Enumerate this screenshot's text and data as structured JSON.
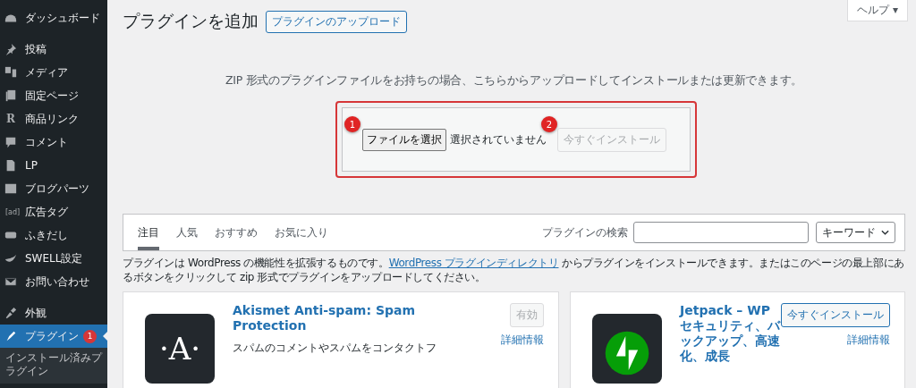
{
  "sidebar": {
    "groups": [
      [
        {
          "label": "ダッシュボード",
          "selected": false
        }
      ],
      [
        {
          "label": "投稿",
          "selected": false
        },
        {
          "label": "メディア",
          "selected": false
        },
        {
          "label": "固定ページ",
          "selected": false
        },
        {
          "label": "商品リンク",
          "selected": false,
          "icon_text": "R"
        },
        {
          "label": "コメント",
          "selected": false
        },
        {
          "label": "LP",
          "selected": false
        },
        {
          "label": "ブログパーツ",
          "selected": false
        },
        {
          "label": "広告タグ",
          "selected": false,
          "icon_text": "[ad]"
        },
        {
          "label": "ふきだし",
          "selected": false
        },
        {
          "label": "SWELL設定",
          "selected": false
        },
        {
          "label": "お問い合わせ",
          "selected": false
        }
      ],
      [
        {
          "label": "外観",
          "selected": false
        },
        {
          "label": "プラグイン",
          "selected": true,
          "badge": "1",
          "children": [
            {
              "label": "インストール済みプラグイン",
              "selected": false
            }
          ]
        }
      ]
    ]
  },
  "header": {
    "title": "プラグインを追加",
    "upload_button": "プラグインのアップロード",
    "help": "ヘルプ ▾"
  },
  "upload": {
    "text": "ZIP 形式のプラグインファイルをお持ちの場合、こちらからアップロードしてインストールまたは更新できます。",
    "file_button": "ファイルを選択",
    "file_status": "選択されていません",
    "install_button": {
      "label": "今すぐインストール",
      "disabled": true
    },
    "markers": [
      "1",
      "2"
    ]
  },
  "filter": {
    "tabs": [
      {
        "label": "注目",
        "selected": true
      },
      {
        "label": "人気",
        "selected": false
      },
      {
        "label": "おすすめ",
        "selected": false
      },
      {
        "label": "お気に入り",
        "selected": false
      }
    ],
    "search_label": "プラグインの検索",
    "search_type": "キーワード"
  },
  "intro": {
    "before": "プラグインは WordPress の機能性を拡張するものです。",
    "link": "WordPress プラグインディレクトリ",
    "after": " からプラグインをインストールできます。またはこのページの最上部にあるボタンをクリックして zip 形式でプラグインをアップロードしてください。"
  },
  "plugins": [
    {
      "kind": "akismet",
      "logo_text": "·A·",
      "name": "Akismet Anti-spam: Spam Protection",
      "action": "有効",
      "action_disabled": true,
      "details": "詳細情報",
      "description": "スパムのコメントやスパムをコンタクトフ"
    },
    {
      "kind": "jetpack",
      "name": "Jetpack – WP セキュリティ、バックアップ、高速化、成長",
      "action": "今すぐインストール",
      "action_disabled": false,
      "details": "詳細情報"
    }
  ]
}
